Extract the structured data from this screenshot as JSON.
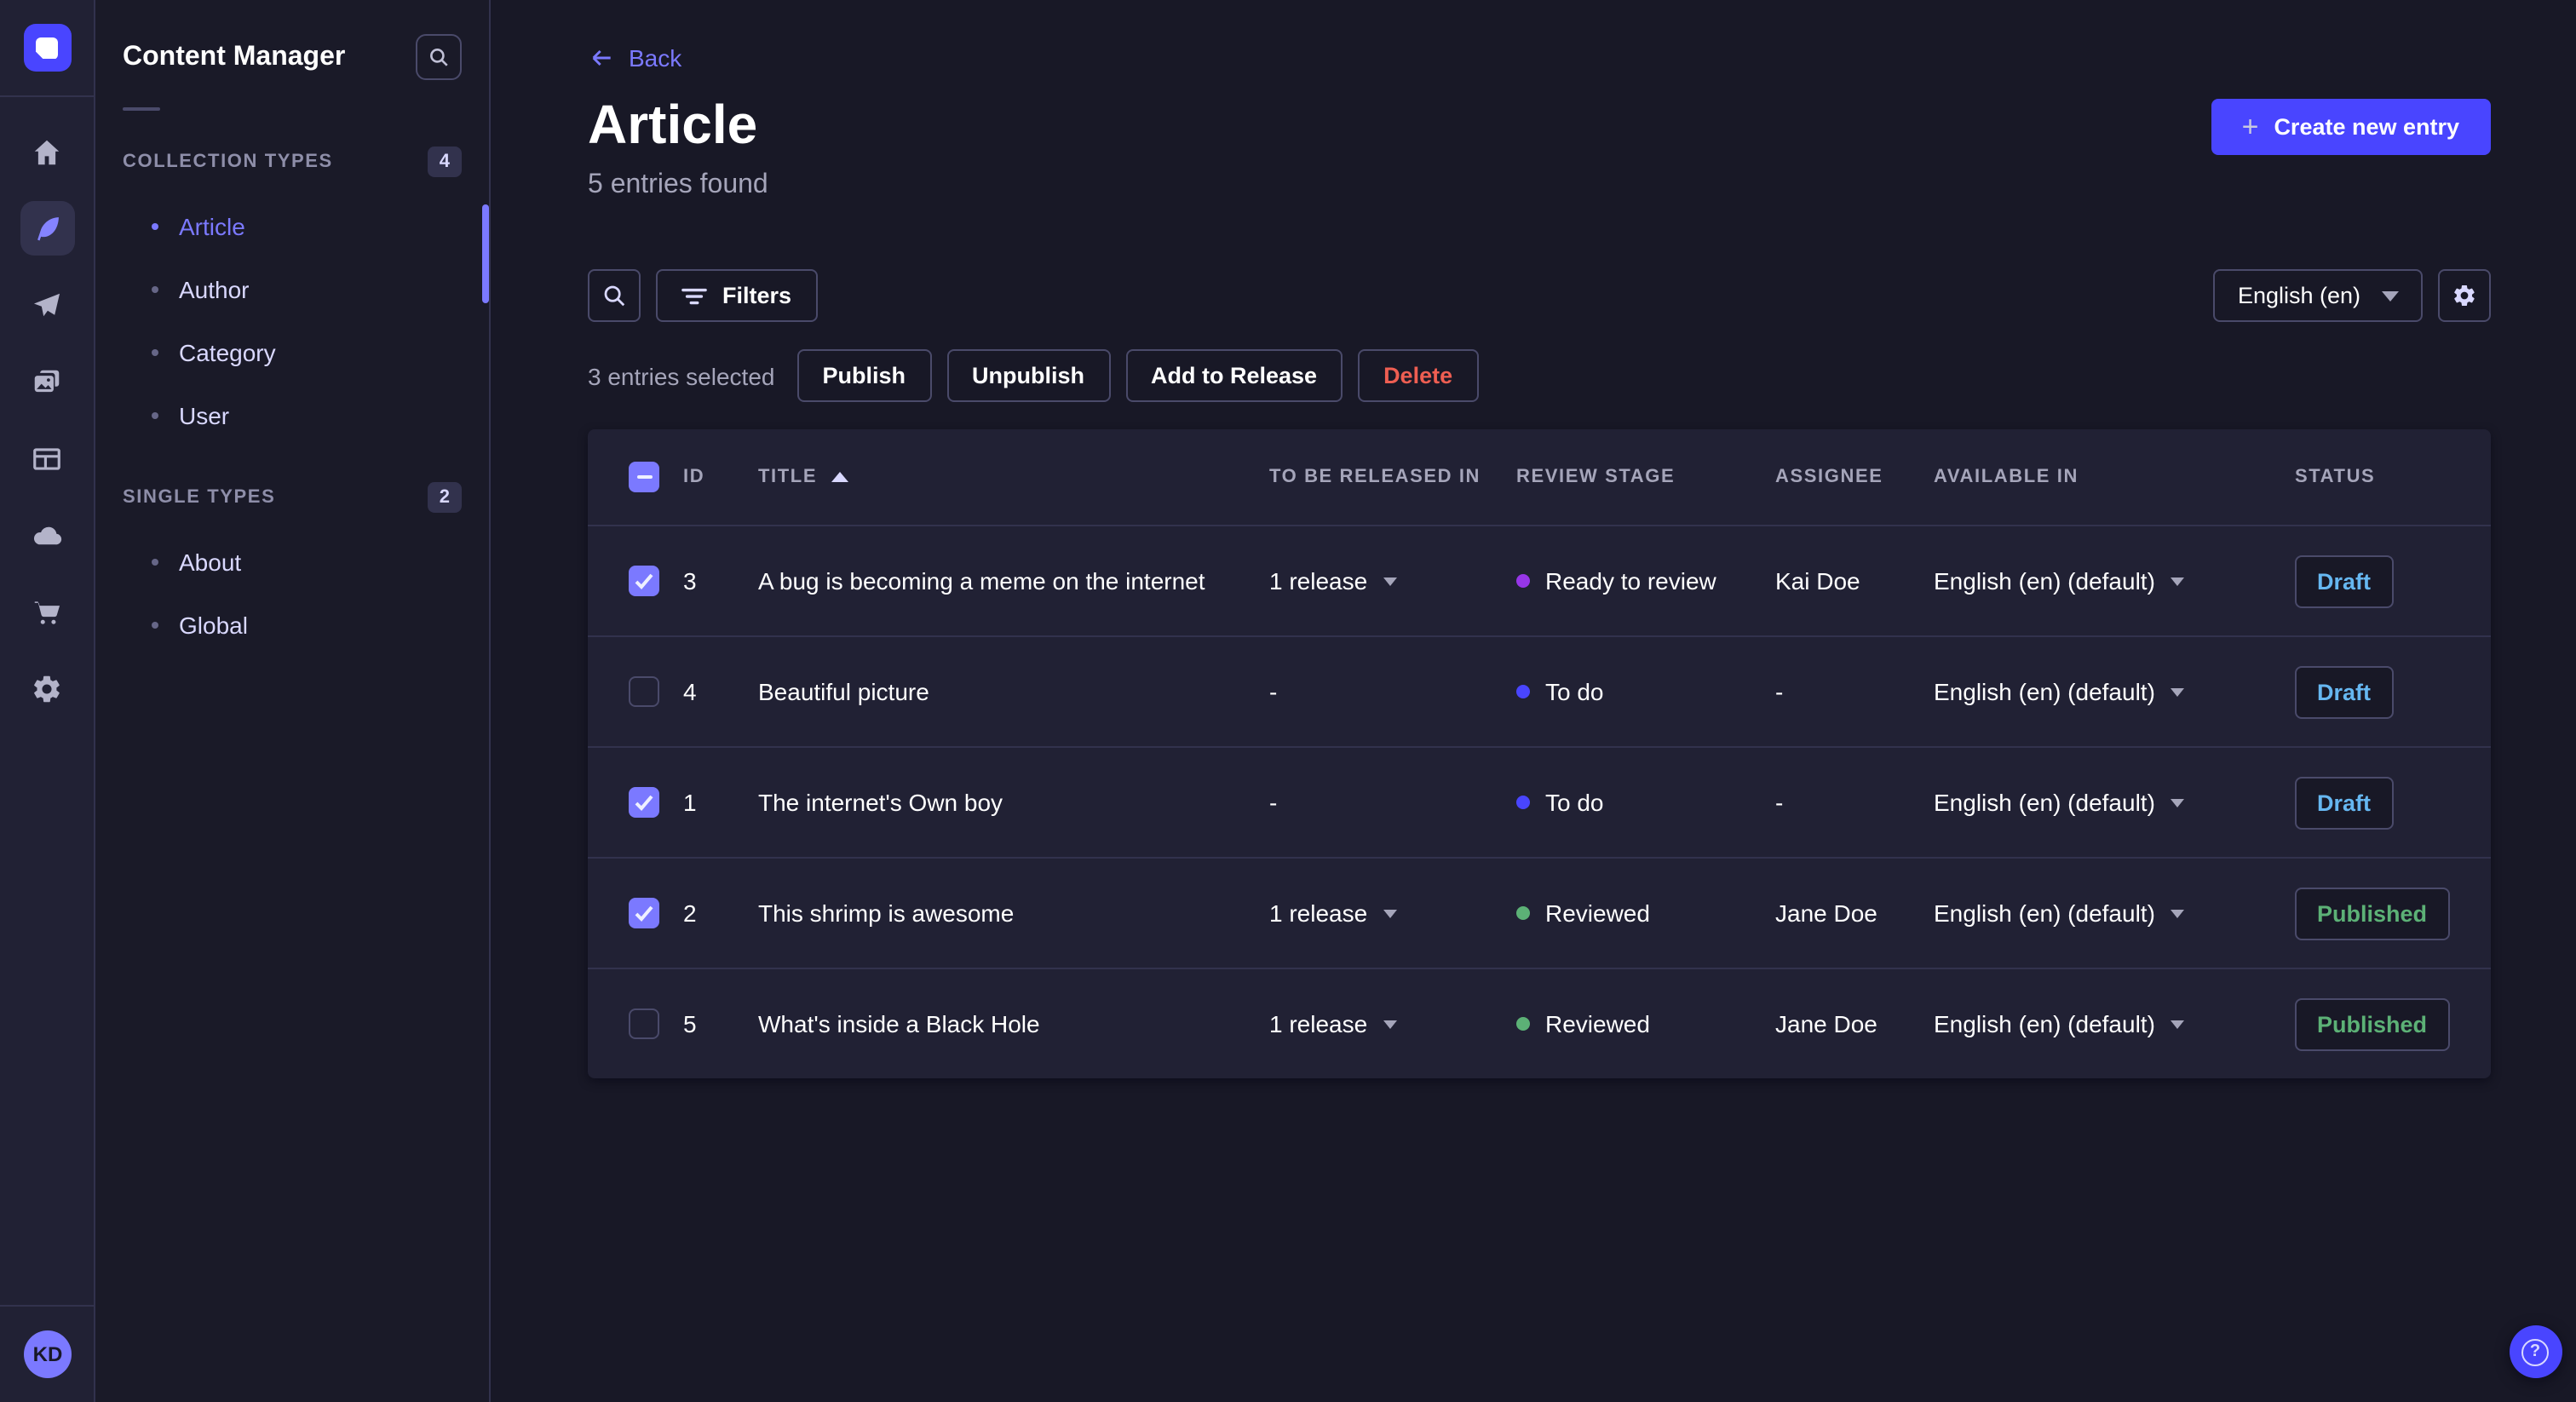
{
  "rail": {
    "icons": [
      "home-icon",
      "content-manager-icon",
      "releases-icon",
      "media-library-icon",
      "content-type-builder-icon",
      "deploy-icon",
      "marketplace-icon",
      "settings-icon"
    ],
    "active_icon": "content-manager-icon",
    "avatar_initials": "KD"
  },
  "subnav": {
    "title": "Content Manager",
    "sections": [
      {
        "label": "COLLECTION TYPES",
        "badge": "4",
        "items": [
          {
            "label": "Article",
            "active": true
          },
          {
            "label": "Author",
            "active": false
          },
          {
            "label": "Category",
            "active": false
          },
          {
            "label": "User",
            "active": false
          }
        ]
      },
      {
        "label": "SINGLE TYPES",
        "badge": "2",
        "items": [
          {
            "label": "About",
            "active": false
          },
          {
            "label": "Global",
            "active": false
          }
        ]
      }
    ]
  },
  "header": {
    "back_label": "Back",
    "title": "Article",
    "subtitle": "5 entries found",
    "create_button": "Create new entry"
  },
  "toolbar": {
    "filters_label": "Filters",
    "locale": "English (en)"
  },
  "selection": {
    "text": "3 entries selected",
    "publish": "Publish",
    "unpublish": "Unpublish",
    "add_to_release": "Add to Release",
    "delete": "Delete"
  },
  "table": {
    "columns": [
      "ID",
      "TITLE",
      "TO BE RELEASED IN",
      "REVIEW STAGE",
      "ASSIGNEE",
      "AVAILABLE IN",
      "STATUS"
    ],
    "sort_column": "TITLE",
    "sort_direction": "ascending",
    "header_checkbox_state": "indeterminate",
    "rows": [
      {
        "checked": true,
        "id": "3",
        "title": "A bug is becoming a meme on the internet",
        "released_in": "1 release",
        "review_stage": "Ready to review",
        "assignee": "Kai Doe",
        "available_in": "English (en) (default)",
        "status": "Draft"
      },
      {
        "checked": false,
        "id": "4",
        "title": "Beautiful picture",
        "released_in": "-",
        "review_stage": "To do",
        "assignee": "-",
        "available_in": "English (en) (default)",
        "status": "Draft"
      },
      {
        "checked": true,
        "id": "1",
        "title": "The internet's Own boy",
        "released_in": "-",
        "review_stage": "To do",
        "assignee": "-",
        "available_in": "English (en) (default)",
        "status": "Draft"
      },
      {
        "checked": true,
        "id": "2",
        "title": "This shrimp is awesome",
        "released_in": "1 release",
        "review_stage": "Reviewed",
        "assignee": "Jane Doe",
        "available_in": "English (en) (default)",
        "status": "Published"
      },
      {
        "checked": false,
        "id": "5",
        "title": "What's inside a Black Hole",
        "released_in": "1 release",
        "review_stage": "Reviewed",
        "assignee": "Jane Doe",
        "available_in": "English (en) (default)",
        "status": "Published"
      }
    ]
  },
  "colors": {
    "page_bg": "#181826",
    "rail_bg": "#212134",
    "card_bg": "#212134",
    "border": "#32324d",
    "input_border": "#4a4a6a",
    "primary": "#4945ff",
    "accent": "#7b79ff",
    "text_muted": "#a5a5ba",
    "danger": "#ee5e52",
    "status_draft": "#66b7f1",
    "status_published": "#5cb176",
    "stage_ready_to_review": "#9736e8",
    "stage_to_do": "#4945ff",
    "stage_reviewed": "#5cb176"
  }
}
